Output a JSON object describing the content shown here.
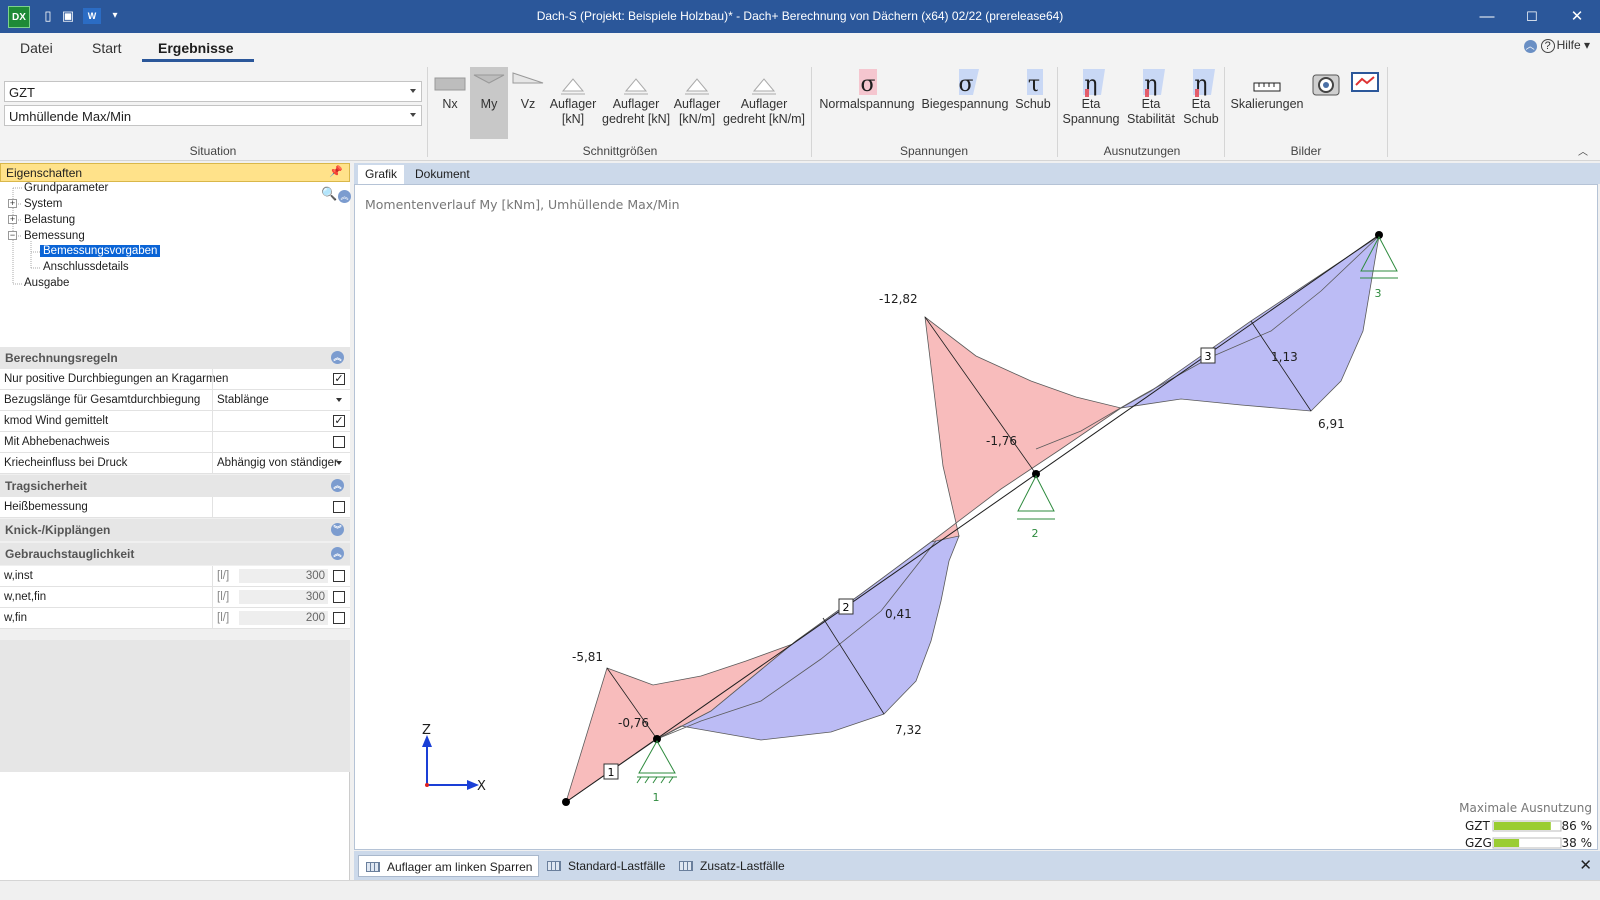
{
  "window": {
    "title": "Dach-S (Projekt: Beispiele Holzbau)* - Dach+ Berechnung von Dächern (x64) 02/22 (prerelease64)",
    "app_logo": "DX",
    "controls": [
      "minimize-icon",
      "maximize-icon",
      "close-icon"
    ]
  },
  "quick_access": [
    "new-file-icon",
    "save-icon",
    "word-export-icon",
    "customize-arrow-icon"
  ],
  "ribbon_tabs": [
    "Datei",
    "Start",
    "Ergebnisse"
  ],
  "active_tab": "Ergebnisse",
  "help": {
    "label": "Hilfe",
    "icon": "help-icon"
  },
  "situation": {
    "label": "Situation",
    "combo1": "GZT",
    "combo2": "Umhüllende Max/Min"
  },
  "groups": {
    "schnittgroessen": {
      "label": "Schnittgrößen",
      "buttons": [
        {
          "label": "Nx"
        },
        {
          "label": "My"
        },
        {
          "label": "Vz"
        },
        {
          "label": "Auflager\n[kN]"
        },
        {
          "label": "Auflager\ngedreht [kN]"
        },
        {
          "label": "Auflager\n[kN/m]"
        },
        {
          "label": "Auflager\ngedreht [kN/m]"
        }
      ],
      "pressed": "My"
    },
    "spannungen": {
      "label": "Spannungen",
      "buttons": [
        {
          "label": "Normalspannung",
          "glyph": "σ"
        },
        {
          "label": "Biegespannung",
          "glyph": "σ"
        },
        {
          "label": "Schub",
          "glyph": "τ"
        }
      ]
    },
    "ausnutzungen": {
      "label": "Ausnutzungen",
      "buttons": [
        {
          "label": "Eta\nSpannung",
          "glyph": "η"
        },
        {
          "label": "Eta\nStabilität",
          "glyph": "η"
        },
        {
          "label": "Eta\nSchub",
          "glyph": "η"
        }
      ]
    },
    "bilder": {
      "label": "Bilder",
      "buttons": [
        {
          "label": "Skalierungen"
        },
        {
          "label": ""
        },
        {
          "label": ""
        }
      ]
    }
  },
  "properties": {
    "header": "Eigenschaften",
    "tree": [
      "Grundparameter",
      "System",
      "Belastung",
      "Bemessung",
      "Bemessungsvorgaben",
      "Anschlussdetails",
      "Ausgabe"
    ],
    "selected": "Bemessungsvorgaben",
    "sections": {
      "berechnungsregeln": {
        "title": "Berechnungsregeln",
        "rows": [
          {
            "label": "Nur positive Durchbiegungen an Kragarmen",
            "checked": true
          },
          {
            "label": "Bezugslänge für Gesamtdurchbiegung",
            "value": "Stablänge"
          },
          {
            "label": "kmod Wind gemittelt",
            "checked": true
          },
          {
            "label": "Mit Abhebenachweis",
            "checked": false
          },
          {
            "label": "Kriecheinfluss bei Druck",
            "value": "Abhängig von ständiger"
          }
        ]
      },
      "tragsicherheit": {
        "title": "Tragsicherheit",
        "rows": [
          {
            "label": "Heißbemessung",
            "checked": false
          }
        ]
      },
      "knick": {
        "title": "Knick-/Kipplängen"
      },
      "gebrauch": {
        "title": "Gebrauchstauglichkeit",
        "rows": [
          {
            "label": "w,inst",
            "unit": "[l/]",
            "value": "300",
            "checked": false
          },
          {
            "label": "w,net,fin",
            "unit": "[l/]",
            "value": "300",
            "checked": false
          },
          {
            "label": "w,fin",
            "unit": "[l/]",
            "value": "200",
            "checked": false
          }
        ]
      }
    }
  },
  "doc_tabs": [
    "Grafik",
    "Dokument"
  ],
  "active_doc_tab": "Grafik",
  "graphic": {
    "caption": "Momentenverlauf My [kNm], Umhüllende Max/Min",
    "moment_labels": [
      "-12,82",
      "-1,76",
      "-5,81",
      "-0,76",
      "0,41",
      "7,32",
      "1,13",
      "6,91"
    ],
    "bar_numbers": [
      "1",
      "2",
      "3"
    ],
    "support_numbers": [
      "1",
      "2",
      "3"
    ],
    "axes": {
      "z": "Z",
      "x": "X"
    },
    "utilization": {
      "title": "Maximale Ausnutzung",
      "rows": [
        {
          "label": "GZT",
          "value": "86 %",
          "fraction": 0.86
        },
        {
          "label": "GZG",
          "value": "38 %",
          "fraction": 0.38
        }
      ]
    },
    "colors": {
      "min": "#f8bcbc",
      "max": "#bcbcf5",
      "support": "#2e8b3e",
      "bar_fill": "#9acd32"
    }
  },
  "bottom_tabs": [
    "Auflager am linken Sparren",
    "Standard-Lastfälle",
    "Zusatz-Lastfälle"
  ],
  "active_bottom_tab": "Auflager am linken Sparren"
}
